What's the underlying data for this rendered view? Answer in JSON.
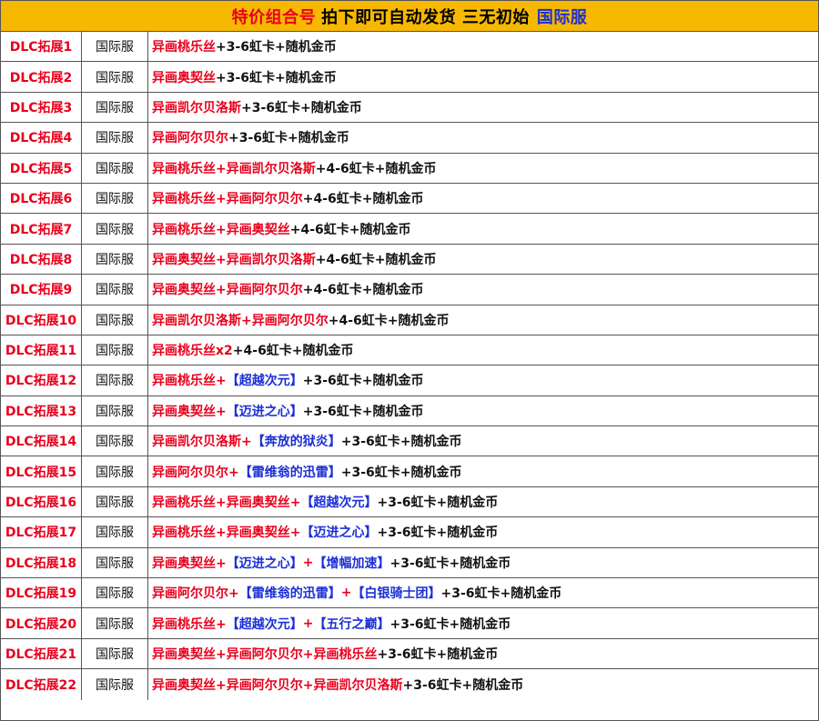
{
  "header": {
    "part1": "特价组合号",
    "part2": "拍下即可自动发货 三无初始",
    "part3": "国际服"
  },
  "colors": {
    "red": "#e8001c",
    "blue": "#1b2fd6",
    "black": "#111111",
    "header_bg": "#f6b800"
  },
  "rows": [
    {
      "id": "DLC拓展1",
      "server": "国际服",
      "segments": [
        {
          "t": "异画桃乐丝",
          "c": "red"
        },
        {
          "t": "+3-6虹卡+随机金币",
          "c": "black"
        }
      ]
    },
    {
      "id": "DLC拓展2",
      "server": "国际服",
      "segments": [
        {
          "t": "异画奥契丝",
          "c": "red"
        },
        {
          "t": "+3-6虹卡+随机金币",
          "c": "black"
        }
      ]
    },
    {
      "id": "DLC拓展3",
      "server": "国际服",
      "segments": [
        {
          "t": "异画凯尔贝洛斯",
          "c": "red"
        },
        {
          "t": "+3-6虹卡+随机金币",
          "c": "black"
        }
      ]
    },
    {
      "id": "DLC拓展4",
      "server": "国际服",
      "segments": [
        {
          "t": "异画阿尔贝尔",
          "c": "red"
        },
        {
          "t": "+3-6虹卡+随机金币",
          "c": "black"
        }
      ]
    },
    {
      "id": "DLC拓展5",
      "server": "国际服",
      "segments": [
        {
          "t": "异画桃乐丝+异画凯尔贝洛斯",
          "c": "red"
        },
        {
          "t": "+4-6虹卡+随机金币",
          "c": "black"
        }
      ]
    },
    {
      "id": "DLC拓展6",
      "server": "国际服",
      "segments": [
        {
          "t": "异画桃乐丝+异画阿尔贝尔",
          "c": "red"
        },
        {
          "t": "+4-6虹卡+随机金币",
          "c": "black"
        }
      ]
    },
    {
      "id": "DLC拓展7",
      "server": "国际服",
      "segments": [
        {
          "t": "异画桃乐丝+异画奥契丝",
          "c": "red"
        },
        {
          "t": "+4-6虹卡+随机金币",
          "c": "black"
        }
      ]
    },
    {
      "id": "DLC拓展8",
      "server": "国际服",
      "segments": [
        {
          "t": "异画奥契丝+异画凯尔贝洛斯",
          "c": "red"
        },
        {
          "t": "+4-6虹卡+随机金币",
          "c": "black"
        }
      ]
    },
    {
      "id": "DLC拓展9",
      "server": "国际服",
      "segments": [
        {
          "t": "异画奥契丝+异画阿尔贝尔",
          "c": "red"
        },
        {
          "t": "+4-6虹卡+随机金币",
          "c": "black"
        }
      ]
    },
    {
      "id": "DLC拓展10",
      "server": "国际服",
      "segments": [
        {
          "t": "异画凯尔贝洛斯+异画阿尔贝尔",
          "c": "red"
        },
        {
          "t": "+4-6虹卡+随机金币",
          "c": "black"
        }
      ]
    },
    {
      "id": "DLC拓展11",
      "server": "国际服",
      "segments": [
        {
          "t": "异画桃乐丝x2",
          "c": "red"
        },
        {
          "t": "+4-6虹卡+随机金币",
          "c": "black"
        }
      ]
    },
    {
      "id": "DLC拓展12",
      "server": "国际服",
      "segments": [
        {
          "t": "异画桃乐丝+",
          "c": "red"
        },
        {
          "t": "【超越次元】",
          "c": "blue"
        },
        {
          "t": "+3-6虹卡+随机金币",
          "c": "black"
        }
      ]
    },
    {
      "id": "DLC拓展13",
      "server": "国际服",
      "segments": [
        {
          "t": "异画奥契丝+",
          "c": "red"
        },
        {
          "t": "【迈进之心】",
          "c": "blue"
        },
        {
          "t": "+3-6虹卡+随机金币",
          "c": "black"
        }
      ]
    },
    {
      "id": "DLC拓展14",
      "server": "国际服",
      "segments": [
        {
          "t": "异画凯尔贝洛斯+",
          "c": "red"
        },
        {
          "t": "【奔放的狱炎】",
          "c": "blue"
        },
        {
          "t": "+3-6虹卡+随机金币",
          "c": "black"
        }
      ]
    },
    {
      "id": "DLC拓展15",
      "server": "国际服",
      "segments": [
        {
          "t": "异画阿尔贝尔+",
          "c": "red"
        },
        {
          "t": "【雷维翁的迅雷】",
          "c": "blue"
        },
        {
          "t": "+3-6虹卡+随机金币",
          "c": "black"
        }
      ]
    },
    {
      "id": "DLC拓展16",
      "server": "国际服",
      "segments": [
        {
          "t": "异画桃乐丝+异画奥契丝+",
          "c": "red"
        },
        {
          "t": "【超越次元】",
          "c": "blue"
        },
        {
          "t": "+3-6虹卡+随机金币",
          "c": "black"
        }
      ]
    },
    {
      "id": "DLC拓展17",
      "server": "国际服",
      "segments": [
        {
          "t": "异画桃乐丝+异画奥契丝+",
          "c": "red"
        },
        {
          "t": "【迈进之心】",
          "c": "blue"
        },
        {
          "t": "+3-6虹卡+随机金币",
          "c": "black"
        }
      ]
    },
    {
      "id": "DLC拓展18",
      "server": "国际服",
      "segments": [
        {
          "t": "异画奥契丝+",
          "c": "red"
        },
        {
          "t": "【迈进之心】",
          "c": "blue"
        },
        {
          "t": "+",
          "c": "red"
        },
        {
          "t": "【增幅加速】",
          "c": "blue"
        },
        {
          "t": "+3-6虹卡+随机金币",
          "c": "black"
        }
      ]
    },
    {
      "id": "DLC拓展19",
      "server": "国际服",
      "segments": [
        {
          "t": "异画阿尔贝尔+",
          "c": "red"
        },
        {
          "t": "【雷维翁的迅雷】",
          "c": "blue"
        },
        {
          "t": "+",
          "c": "red"
        },
        {
          "t": "【白银骑士团】",
          "c": "blue"
        },
        {
          "t": "+3-6虹卡+随机金币",
          "c": "black"
        }
      ]
    },
    {
      "id": "DLC拓展20",
      "server": "国际服",
      "segments": [
        {
          "t": "异画桃乐丝+",
          "c": "red"
        },
        {
          "t": "【超越次元】",
          "c": "blue"
        },
        {
          "t": "+",
          "c": "red"
        },
        {
          "t": "【五行之巅】",
          "c": "blue"
        },
        {
          "t": "+3-6虹卡+随机金币",
          "c": "black"
        }
      ]
    },
    {
      "id": "DLC拓展21",
      "server": "国际服",
      "segments": [
        {
          "t": "异画奥契丝+异画阿尔贝尔+异画桃乐丝",
          "c": "red"
        },
        {
          "t": "+3-6虹卡+随机金币",
          "c": "black"
        }
      ]
    },
    {
      "id": "DLC拓展22",
      "server": "国际服",
      "segments": [
        {
          "t": "异画奥契丝+异画阿尔贝尔+异画凯尔贝洛斯",
          "c": "red"
        },
        {
          "t": "+3-6虹卡+随机金币",
          "c": "black"
        }
      ]
    }
  ]
}
